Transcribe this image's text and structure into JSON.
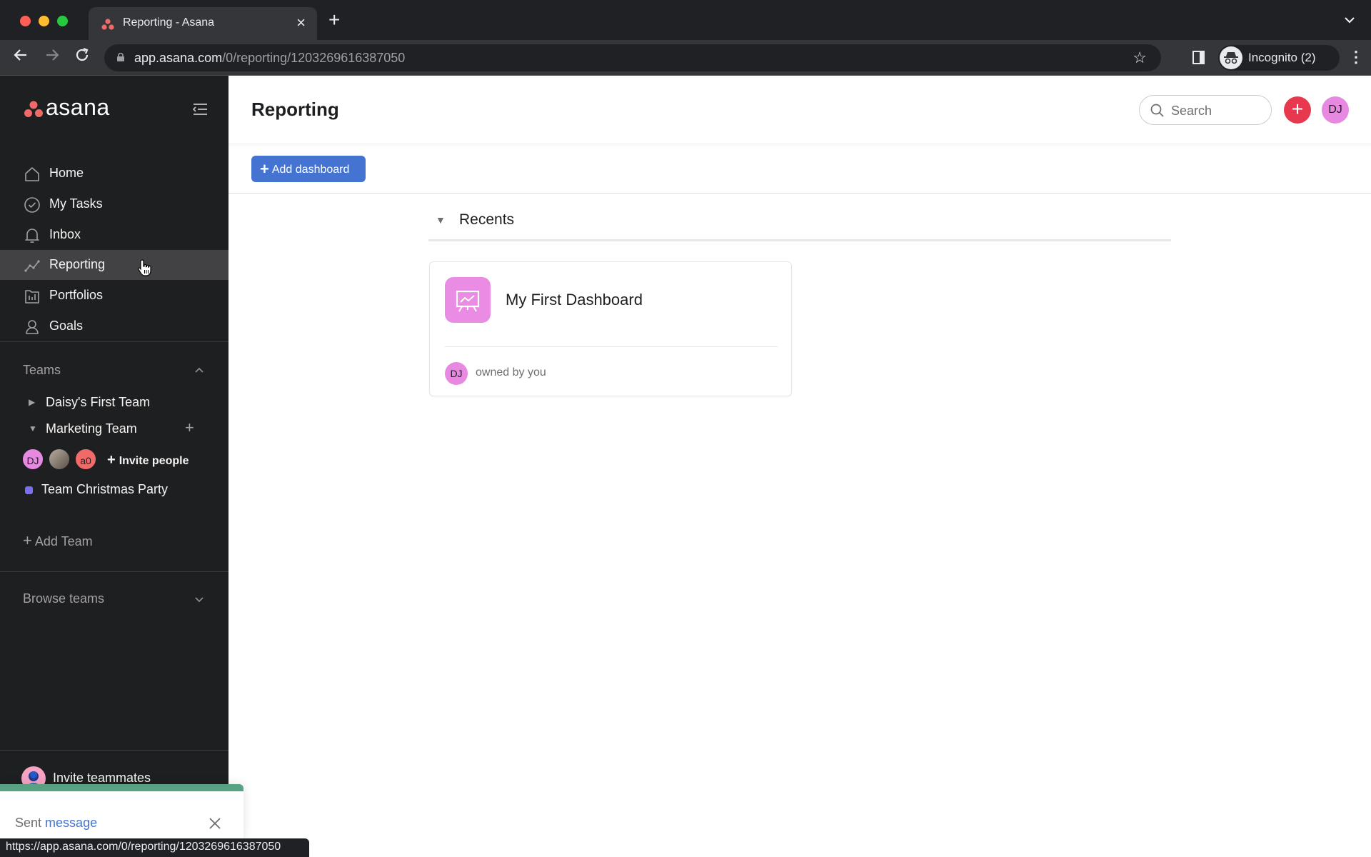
{
  "browser": {
    "tab_title": "Reporting - Asana",
    "url_host": "app.asana.com",
    "url_path": "/0/reporting/1203269616387050",
    "profile_label": "Incognito (2)",
    "status_url": "https://app.asana.com/0/reporting/1203269616387050"
  },
  "sidebar": {
    "logo_text": "asana",
    "nav": [
      {
        "label": "Home",
        "icon": "home-icon"
      },
      {
        "label": "My Tasks",
        "icon": "check-circle-icon"
      },
      {
        "label": "Inbox",
        "icon": "bell-icon"
      },
      {
        "label": "Reporting",
        "icon": "line-chart-icon",
        "active": true
      },
      {
        "label": "Portfolios",
        "icon": "portfolio-icon"
      },
      {
        "label": "Goals",
        "icon": "goal-icon"
      }
    ],
    "teams_title": "Teams",
    "teams": [
      {
        "label": "Daisy's First Team",
        "expanded": false
      },
      {
        "label": "Marketing Team",
        "expanded": true
      }
    ],
    "members": [
      {
        "initials": "DJ",
        "color": "#e789e0"
      },
      {
        "initials": "",
        "color": "#8a7f74"
      },
      {
        "initials": "a0",
        "color": "#f06a6a"
      }
    ],
    "invite_people": "Invite people",
    "projects": [
      {
        "label": "Team Christmas Party",
        "color": "#7a6ff0"
      }
    ],
    "add_team": "Add Team",
    "browse_teams": "Browse teams",
    "invite_teammates": "Invite teammates"
  },
  "header": {
    "title": "Reporting",
    "search_placeholder": "Search",
    "user_initials": "DJ"
  },
  "toolbar": {
    "add_dashboard": "Add dashboard"
  },
  "recents": {
    "title": "Recents",
    "cards": [
      {
        "title": "My First Dashboard",
        "owner_initials": "DJ",
        "owner_text": "owned by you"
      }
    ]
  },
  "toast": {
    "prefix": "Sent",
    "link": "message"
  },
  "colors": {
    "brand": "#f06a6a",
    "primary_button": "#4573d2",
    "sidebar_bg": "#1e1f21",
    "toast_accent": "#58a182"
  }
}
